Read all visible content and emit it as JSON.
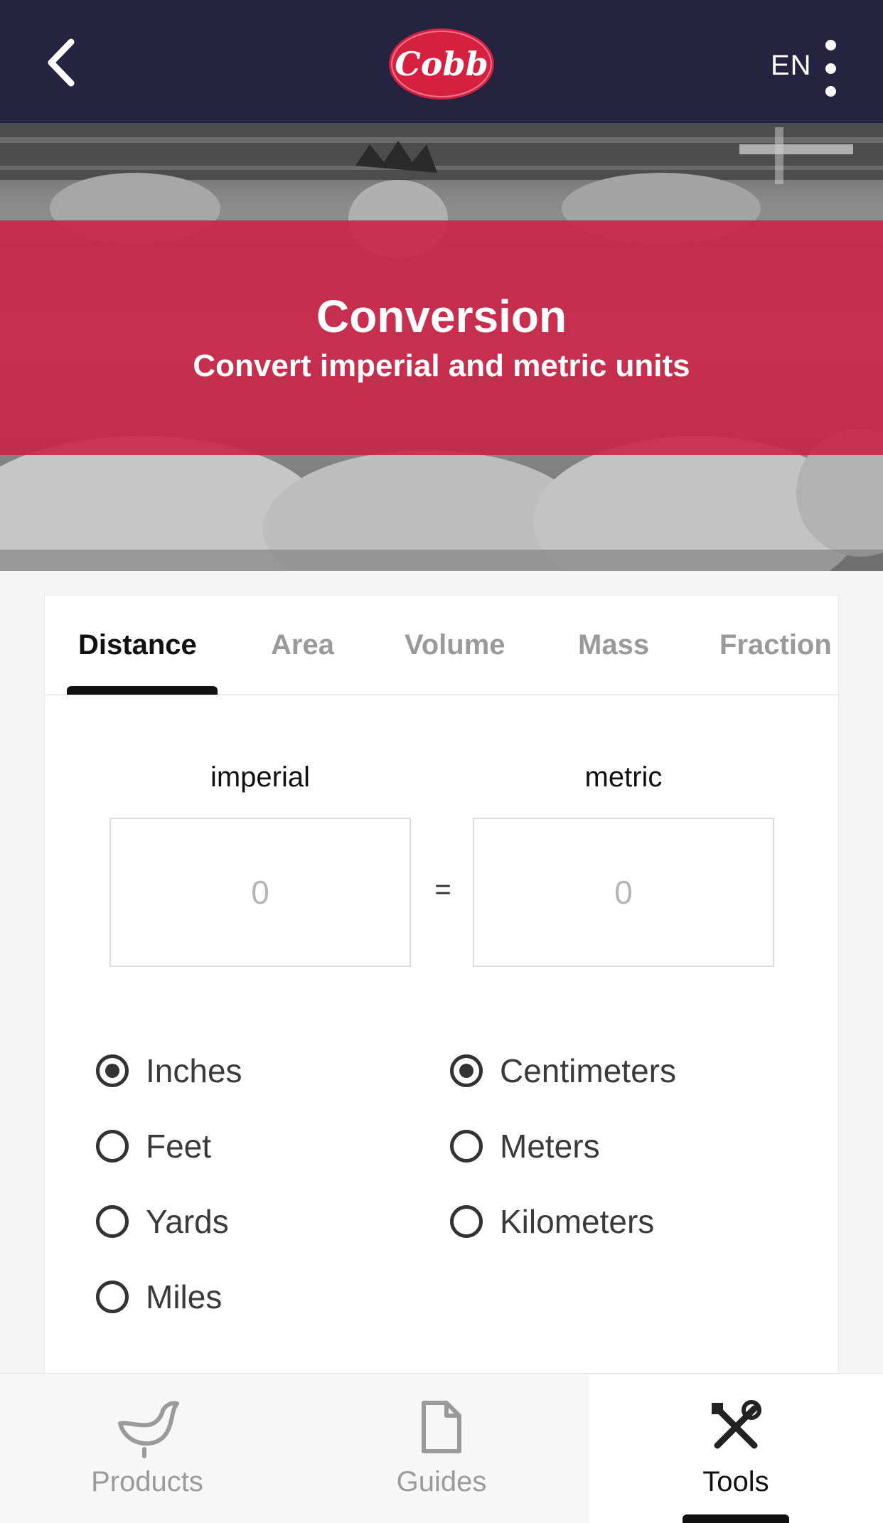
{
  "header": {
    "back_icon": "chevron-left-icon",
    "logo_text": "Cobb",
    "language": "EN",
    "menu_icon": "kebab-menu-icon"
  },
  "hero": {
    "title": "Conversion",
    "subtitle": "Convert imperial and metric units"
  },
  "tabs": [
    {
      "label": "Distance",
      "active": true
    },
    {
      "label": "Area",
      "active": false
    },
    {
      "label": "Volume",
      "active": false
    },
    {
      "label": "Mass",
      "active": false
    },
    {
      "label": "Fraction",
      "active": false
    }
  ],
  "converter": {
    "imperial_label": "imperial",
    "metric_label": "metric",
    "imperial_placeholder": "0",
    "metric_placeholder": "0",
    "equals": "=",
    "imperial_units": [
      {
        "label": "Inches",
        "selected": true
      },
      {
        "label": "Feet",
        "selected": false
      },
      {
        "label": "Yards",
        "selected": false
      },
      {
        "label": "Miles",
        "selected": false
      }
    ],
    "metric_units": [
      {
        "label": "Centimeters",
        "selected": true
      },
      {
        "label": "Meters",
        "selected": false
      },
      {
        "label": "Kilometers",
        "selected": false
      }
    ]
  },
  "bottom_nav": [
    {
      "label": "Products",
      "icon": "chicken-icon",
      "active": false
    },
    {
      "label": "Guides",
      "icon": "document-icon",
      "active": false
    },
    {
      "label": "Tools",
      "icon": "tools-icon",
      "active": true
    }
  ],
  "colors": {
    "header_bg": "#25233f",
    "brand_red": "#cd2043",
    "active_text": "#111111",
    "inactive_text": "#9a9a9a"
  }
}
